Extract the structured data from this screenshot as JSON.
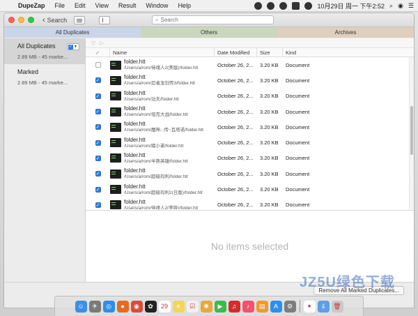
{
  "menubar": {
    "app_name": "DupeZap",
    "menus": [
      "File",
      "Edit",
      "View",
      "Result",
      "Window",
      "Help"
    ],
    "clock": "10月29日 周一 下午2:52"
  },
  "toolbar": {
    "back_label": "Search",
    "search_placeholder": "Search"
  },
  "tabs": [
    {
      "label": "All Duplicates",
      "color": "#c9d6e9"
    },
    {
      "label": "Others",
      "color": "#cad7bd"
    },
    {
      "label": "Archives",
      "color": "#dfcfbd"
    }
  ],
  "sidebar": {
    "items": [
      {
        "title": "All Duplicates",
        "subtitle": "2.89 MB - 45 marke..."
      },
      {
        "title": "Marked",
        "subtitle": "2.89 MB - 45 marke..."
      }
    ]
  },
  "table": {
    "columns": [
      "Name",
      "Date Modified",
      "Size",
      "Kind"
    ],
    "rows": [
      {
        "name": "folder.htt",
        "path": "/Users/a/rom/侍魂人2(美版)/folder.htt",
        "date": "October 26, 2...",
        "size": "3.20 KB",
        "kind": "Document",
        "checked": false
      },
      {
        "name": "folder.htt",
        "path": "/Users/a/rom/忍者龙剑传3/folder.htt",
        "date": "October 26, 2...",
        "size": "3.20 KB",
        "kind": "Document",
        "checked": true
      },
      {
        "name": "folder.htt",
        "path": "/Users/a/rom/功夫/folder.htt",
        "date": "October 26, 2...",
        "size": "3.20 KB",
        "kind": "Document",
        "checked": true
      },
      {
        "name": "folder.htt",
        "path": "/Users/a/rom/坦克大战/folder.htt",
        "date": "October 26, 2...",
        "size": "3.20 KB",
        "kind": "Document",
        "checked": true
      },
      {
        "name": "folder.htt",
        "path": "/Users/a/rom/魔神...传~瓦塔诺/folder.htt",
        "date": "October 26, 2...",
        "size": "3.20 KB",
        "kind": "Document",
        "checked": true
      },
      {
        "name": "folder.htt",
        "path": "/Users/a/rom/猪小弟/folder.htt",
        "date": "October 26, 2...",
        "size": "3.20 KB",
        "kind": "Document",
        "checked": true
      },
      {
        "name": "folder.htt",
        "path": "/Users/a/rom/半熟英雄/folder.htt",
        "date": "October 26, 2...",
        "size": "3.20 KB",
        "kind": "Document",
        "checked": true
      },
      {
        "name": "folder.htt",
        "path": "/Users/a/rom/超级玛利/folder.htt",
        "date": "October 26, 2...",
        "size": "3.20 KB",
        "kind": "Document",
        "checked": true
      },
      {
        "name": "folder.htt",
        "path": "/Users/a/rom/超级玛利2(日版)/folder.htt",
        "date": "October 26, 2...",
        "size": "3.20 KB",
        "kind": "Document",
        "checked": true
      },
      {
        "name": "folder.htt",
        "path": "/Users/a/rom/侍魂人2(美版)/folder.htt",
        "date": "October 26, 2...",
        "size": "3.20 KB",
        "kind": "Document",
        "checked": true
      }
    ]
  },
  "detail": {
    "empty_text": "No items selected"
  },
  "footer": {
    "remove_label": "Remove All Marked Duplicates..."
  },
  "dock": {
    "icons": [
      {
        "name": "finder-icon",
        "color": "#3b8fe6",
        "glyph": "☺"
      },
      {
        "name": "launchpad-icon",
        "color": "#7a7a7a",
        "glyph": "✈"
      },
      {
        "name": "safari-icon",
        "color": "#2b8fe8",
        "glyph": "◎"
      },
      {
        "name": "firefox-icon",
        "color": "#e66b1f",
        "glyph": "●"
      },
      {
        "name": "chrome-icon",
        "color": "#d94b3b",
        "glyph": "◉"
      },
      {
        "name": "qq-icon",
        "color": "#222222",
        "glyph": "✿"
      },
      {
        "name": "calendar-icon",
        "color": "#ffffff",
        "glyph": "29"
      },
      {
        "name": "notes-icon",
        "color": "#f4d55a",
        "glyph": "≡"
      },
      {
        "name": "reminders-icon",
        "color": "#f0f0f0",
        "glyph": "☑"
      },
      {
        "name": "photos-icon",
        "color": "#e8a93a",
        "glyph": "✺"
      },
      {
        "name": "facetime-icon",
        "color": "#3bbb4b",
        "glyph": "▶"
      },
      {
        "name": "netease-music-icon",
        "color": "#d52b2b",
        "glyph": "♫"
      },
      {
        "name": "music-icon",
        "color": "#f05270",
        "glyph": "♪"
      },
      {
        "name": "books-icon",
        "color": "#f09a2c",
        "glyph": "▤"
      },
      {
        "name": "app-store-icon",
        "color": "#2f8ff0",
        "glyph": "A"
      },
      {
        "name": "system-preferences-icon",
        "color": "#7d7d7d",
        "glyph": "⚙"
      },
      {
        "name": "dupezap-icon",
        "color": "#ffffff",
        "glyph": "✦"
      },
      {
        "name": "downloads-icon",
        "color": "#5aa0e8",
        "glyph": "⇓"
      },
      {
        "name": "trash-icon",
        "color": "#c9c9c9",
        "glyph": "🗑"
      }
    ]
  },
  "watermark": "JZ5U绿色下载"
}
